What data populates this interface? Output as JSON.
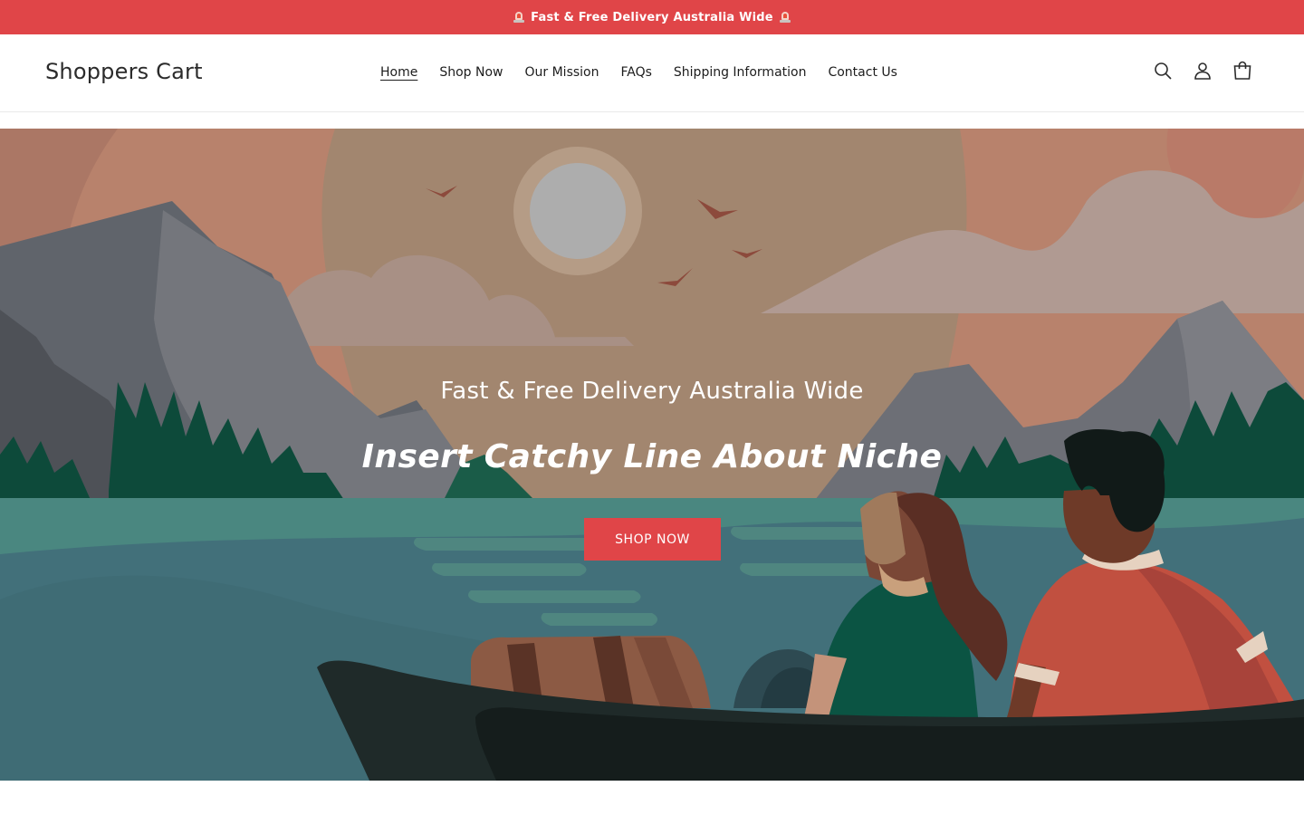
{
  "announcement": {
    "text": "Fast & Free Delivery Australia Wide",
    "icon": "police-light-icon",
    "background": "#e04548"
  },
  "header": {
    "logo": "Shoppers Cart",
    "nav": [
      {
        "label": "Home",
        "active": true
      },
      {
        "label": "Shop Now",
        "active": false
      },
      {
        "label": "Our Mission",
        "active": false
      },
      {
        "label": "FAQs",
        "active": false
      },
      {
        "label": "Shipping Information",
        "active": false
      },
      {
        "label": "Contact Us",
        "active": false
      }
    ],
    "icons": [
      "search-icon",
      "account-icon",
      "cart-icon"
    ]
  },
  "hero": {
    "subtitle": "Fast & Free Delivery Australia Wide",
    "title": "Insert Catchy Line About Niche",
    "button_label": "SHOP NOW",
    "button_color": "#e04548"
  }
}
